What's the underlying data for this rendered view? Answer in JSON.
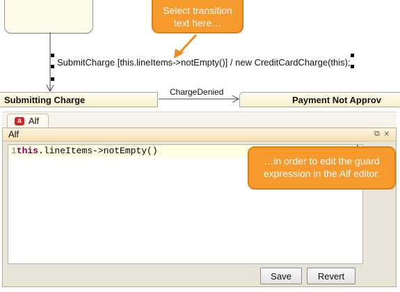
{
  "diagram": {
    "transition_text": "SubmitCharge [this.lineItems->notEmpty()] / new  CreditCardCharge(this);",
    "state_left": "Submitting Charge",
    "state_right": "Payment Not Approv",
    "transition_label": "ChargeDenied"
  },
  "tab": {
    "label": "Alf",
    "badge": "a"
  },
  "panel": {
    "title": "Alf",
    "restore_icon": "restore-icon",
    "close_icon": "close-icon",
    "close_glyph": "×",
    "restore_glyph": "⧉"
  },
  "editor": {
    "line_number": "1",
    "keyword": "this",
    "code_rest": ".lineItems->notEmpty()"
  },
  "buttons": {
    "save": "Save",
    "revert": "Revert"
  },
  "callouts": {
    "top_line1": "Select transition",
    "top_line2": "text here…",
    "right_line1": "…in order to edit the guard",
    "right_line2": "expression in the Alf editor."
  },
  "colors": {
    "callout": "#f79a2e",
    "arrow": "#f08a1c",
    "state_fill": "#fdfbe8",
    "panel_header": "#f5e3b6"
  }
}
